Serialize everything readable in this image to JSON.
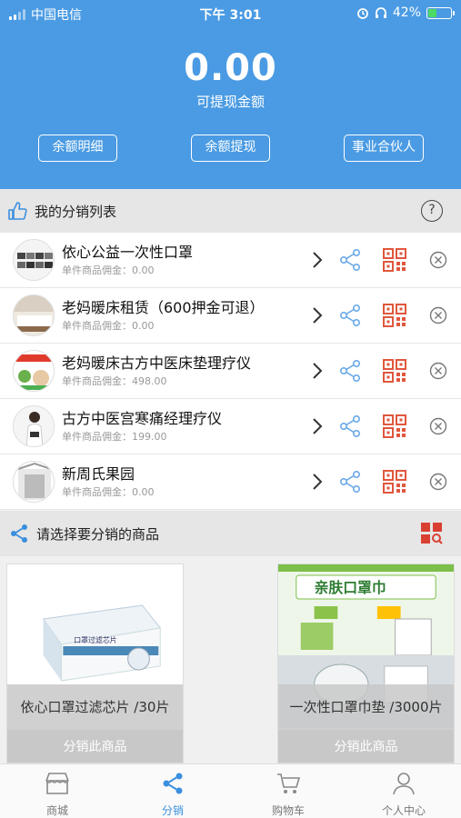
{
  "status_bar": {
    "carrier": "中国电信",
    "time": "下午 3:01",
    "battery": "42%",
    "battery_level": 0.42
  },
  "header": {
    "balance": "0.00",
    "balance_label": "可提现金额",
    "buttons": [
      "余额明细",
      "余额提现",
      "事业合伙人"
    ]
  },
  "my_list": {
    "title": "我的分销列表",
    "help_symbol": "?",
    "items": [
      {
        "name": "依心公益一次性口罩",
        "commission": "单件商品佣金：0.00"
      },
      {
        "name": "老妈暖床租赁（600押金可退）",
        "commission": "单件商品佣金：0.00"
      },
      {
        "name": "老妈暖床古方中医床垫理疗仪",
        "commission": "单件商品佣金：498.00"
      },
      {
        "name": "古方中医宫寒痛经理疗仪",
        "commission": "单件商品佣金：199.00"
      },
      {
        "name": "新周氏果园",
        "commission": "单件商品佣金：0.00"
      }
    ]
  },
  "select_section": {
    "title": "请选择要分销的商品"
  },
  "products": [
    {
      "name": "依心口罩过滤芯片 /30片",
      "action": "分销此商品",
      "image_text": "口罩过滤芯片"
    },
    {
      "name": "一次性口罩巾垫 /3000片",
      "action": "分销此商品",
      "image_text": "亲肤口罩巾"
    }
  ],
  "tabbar": {
    "tabs": [
      {
        "label": "商城",
        "icon": "shop-icon"
      },
      {
        "label": "分销",
        "icon": "share-icon"
      },
      {
        "label": "购物车",
        "icon": "cart-icon"
      },
      {
        "label": "个人中心",
        "icon": "person-icon"
      }
    ]
  },
  "colors": {
    "header_blue": "#4a9be3",
    "qr_red": "#e0573d",
    "share_blue": "#6aa9e8",
    "active_tab": "#3a8fde"
  }
}
